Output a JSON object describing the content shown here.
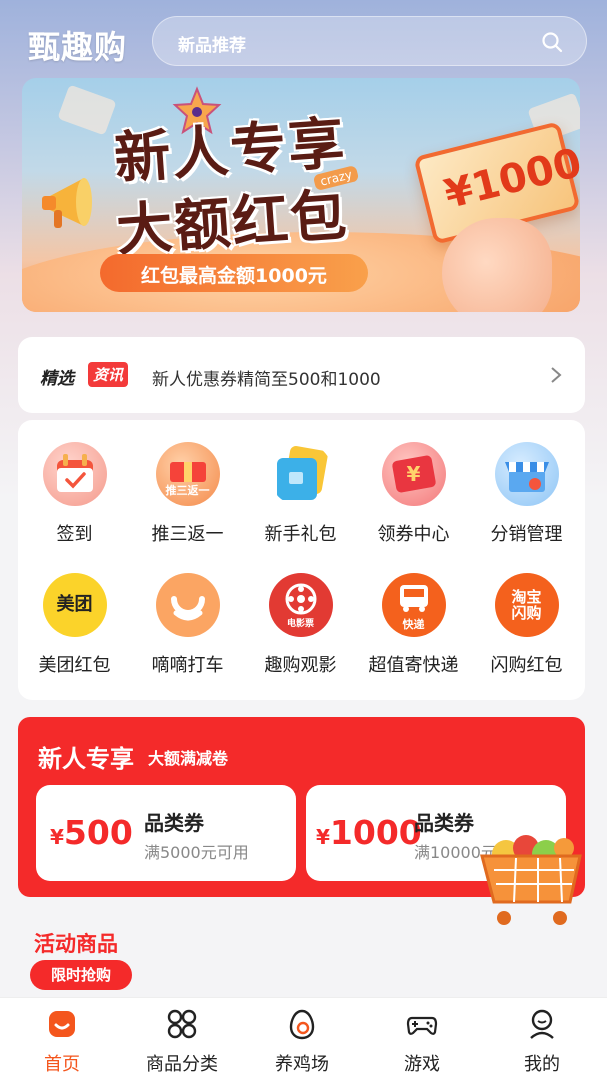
{
  "header": {
    "logo": "甄趣购",
    "search_placeholder": "新品推荐"
  },
  "banner": {
    "title_line1": "新人专享",
    "title_line2": "大额红包",
    "tag": "crazy",
    "ribbon": "红包最高金额1000元",
    "coupon_value": "¥1000"
  },
  "news": {
    "badge_left": "精选",
    "badge_right": "资讯",
    "text": "新人优惠券精简至500和1000"
  },
  "services": [
    {
      "label": "签到",
      "icon": "calendar-icon"
    },
    {
      "label": "推三返一",
      "icon": "gift-box-icon",
      "inner": "推三返一"
    },
    {
      "label": "新手礼包",
      "icon": "cards-icon"
    },
    {
      "label": "领券中心",
      "icon": "red-envelope-icon",
      "inner": "¥"
    },
    {
      "label": "分销管理",
      "icon": "store-icon"
    },
    {
      "label": "美团红包",
      "icon": "meituan-icon",
      "inner": "美团"
    },
    {
      "label": "嘀嘀打车",
      "icon": "didi-icon"
    },
    {
      "label": "趣购观影",
      "icon": "film-reel-icon",
      "inner": "电影票"
    },
    {
      "label": "超值寄快递",
      "icon": "truck-icon",
      "inner": "快递"
    },
    {
      "label": "闪购红包",
      "icon": "taobao-icon",
      "inner": "淘宝闪购"
    }
  ],
  "newcomer": {
    "title": "新人专享",
    "subtitle": "大额满减卷",
    "vouchers": [
      {
        "currency": "¥",
        "amount": "500",
        "title": "品类券",
        "condition": "满5000元可用"
      },
      {
        "currency": "¥",
        "amount": "1000",
        "title": "品类券",
        "condition": "满10000元可用"
      }
    ]
  },
  "activity": {
    "title": "活动商品",
    "badge": "限时抢购"
  },
  "tabbar": {
    "items": [
      {
        "label": "首页",
        "icon": "home-icon",
        "active": true
      },
      {
        "label": "商品分类",
        "icon": "category-grid-icon",
        "active": false
      },
      {
        "label": "养鸡场",
        "icon": "egg-icon",
        "active": false
      },
      {
        "label": "游戏",
        "icon": "gamepad-icon",
        "active": false
      },
      {
        "label": "我的",
        "icon": "profile-icon",
        "active": false
      }
    ]
  },
  "colors": {
    "accent_red": "#f42a2a",
    "active_tab": "#f4561d"
  }
}
